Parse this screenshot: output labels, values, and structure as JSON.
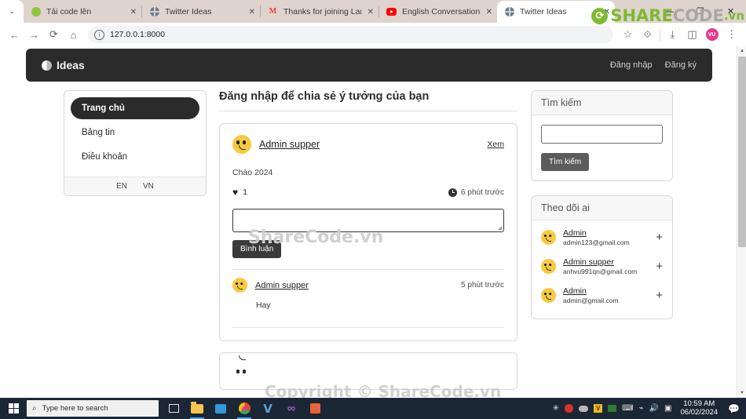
{
  "browser": {
    "tabs": [
      {
        "title": "Tải code lên",
        "favicon": "sharecode-icon",
        "active": false
      },
      {
        "title": "Twitter Ideas",
        "favicon": "globe-icon",
        "active": false
      },
      {
        "title": "Thanks for joining Laravel -",
        "favicon": "gmail-icon",
        "active": false
      },
      {
        "title": "English Conversations for D",
        "favicon": "youtube-icon",
        "active": false
      },
      {
        "title": "Twitter Ideas",
        "favicon": "globe-icon",
        "active": true
      }
    ],
    "tab_close_label": "✕",
    "tab_list_label": "⌄",
    "window_controls": {
      "minimize": "—",
      "maximize": "❐",
      "close": "✕"
    },
    "nav": {
      "back": "←",
      "forward": "→",
      "reload": "⟳",
      "home": "⌂"
    },
    "omnibox": {
      "url": "127.0.0.1:8000",
      "info_icon": "ⓘ"
    },
    "toolbar_right": {
      "bookmark": "☆",
      "extensions": "⟐",
      "downloads": "⤓",
      "sidepanel": "◫",
      "profile_initials": "VU",
      "menu": "⋮"
    },
    "scrollbar": {
      "up": "▲",
      "down": "▼"
    }
  },
  "overlay": {
    "logo": {
      "share": "SHARE",
      "code": "CODE",
      "vn": ".vn",
      "mark": "⟳"
    },
    "watermark_1": "ShareCode.vn",
    "watermark_2": "Copyright © ShareCode.vn"
  },
  "site": {
    "brand": "Ideas",
    "nav_links": [
      {
        "label": "Đăng nhập"
      },
      {
        "label": "Đăng ký"
      }
    ]
  },
  "sidebar_left": {
    "items": [
      {
        "label": "Trang chủ",
        "active": true
      },
      {
        "label": "Bảng tin",
        "active": false
      },
      {
        "label": "Điều khoản",
        "active": false
      }
    ],
    "languages": [
      {
        "label": "EN"
      },
      {
        "label": "VN"
      }
    ]
  },
  "main": {
    "page_title": "Đăng nhập để chia sẻ ý tưởng của bạn",
    "post": {
      "author": "Admin supper",
      "view_label": "Xem",
      "body": "Chào 2024",
      "like_count": "1",
      "heart_icon": "♥",
      "time_ago": "6 phút trước",
      "comment_placeholder": "",
      "comment_button": "Bình luận",
      "comments": [
        {
          "author": "Admin supper",
          "time_ago": "5 phút trước",
          "text": "Hay"
        }
      ]
    }
  },
  "sidebar_right": {
    "search": {
      "title": "Tìm kiếm",
      "input_value": "",
      "button": "Tìm kiếm"
    },
    "follow": {
      "title": "Theo dõi ai",
      "add_icon": "+",
      "people": [
        {
          "name": "Admin",
          "email": "admin123@gmail.com"
        },
        {
          "name": "Admin supper",
          "email": "anhvu991qn@gmail.com"
        },
        {
          "name": "Admin",
          "email": "admin@gmail.com"
        }
      ]
    }
  },
  "taskbar": {
    "search_placeholder": "Type here to search",
    "search_icon": "search-icon",
    "time": "10:59 AM",
    "date": "06/02/2024",
    "notification_icon": "💬"
  }
}
